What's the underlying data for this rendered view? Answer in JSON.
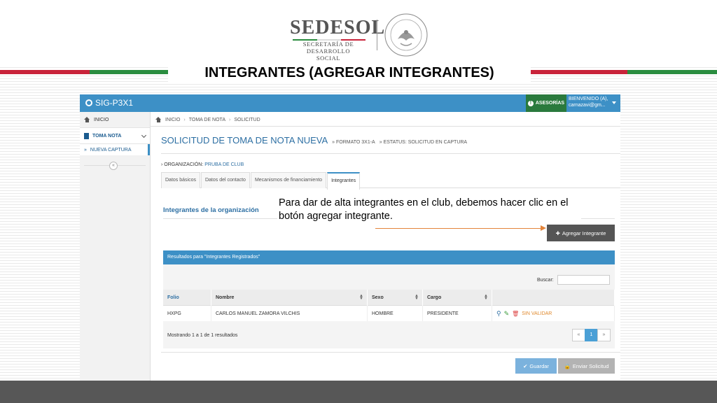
{
  "brand": {
    "name": "SEDESOL",
    "subtitle_1": "SECRETARÍA DE",
    "subtitle_2": "DESARROLLO SOCIAL",
    "colors": {
      "green": "#2a8c3f",
      "red": "#c8233a",
      "gray": "#555555"
    }
  },
  "slide": {
    "title": "INTEGRANTES (AGREGAR INTEGRANTES)"
  },
  "annotation": {
    "text": "Para dar de alta integrantes en el club, debemos hacer clic en el botón agregar integrante.",
    "arrow_color": "#e3843a"
  },
  "topbar": {
    "app_name": "SIG-P3X1",
    "asesorias": "ASESORÍAS",
    "welcome_1": "BIENVENIDO (A),",
    "welcome_2": "carnazavi@gm...",
    "color": "#3d90c6"
  },
  "sidebar": {
    "items": [
      {
        "label": "INICIO",
        "icon": "home-icon"
      },
      {
        "label": "TOMA NOTA",
        "icon": "document-icon"
      }
    ],
    "sub_items": [
      {
        "label": "NUEVA CAPTURA"
      }
    ],
    "toggle_glyph": "«"
  },
  "breadcrumb": {
    "items": [
      "INICIO",
      "TOMA DE NOTA",
      "SOLICITUD"
    ]
  },
  "main": {
    "title": "SOLICITUD DE TOMA DE NOTA NUEVA",
    "formato": "» FORMATO 3X1-A",
    "estatus": "» ESTATUS: SOLICITUD EN CAPTURA",
    "org_label": "ORGANIZACIÓN:",
    "org_value": "PRUBA DE CLUB",
    "tabs": [
      {
        "label": "Datos básicos"
      },
      {
        "label": "Datos del contacto"
      },
      {
        "label": "Mecanismos de financiamiento"
      },
      {
        "label": "Integrantes"
      }
    ],
    "section_title": "Integrantes de la organización",
    "add_button": "Agregar Integrante"
  },
  "results": {
    "header": "Resultados para \"Integrantes Registrados\"",
    "search_label": "Buscar:",
    "search_value": "",
    "columns": [
      "Folio",
      "Nombre",
      "Sexo",
      "Cargo",
      ""
    ],
    "rows": [
      {
        "folio": "HXPG",
        "nombre": "CARLOS MANUEL ZAMORA VILCHIS",
        "sexo": "HOMBRE",
        "cargo": "PRESIDENTE",
        "status": "SIN VALIDAR"
      }
    ],
    "showing": "Mostrando 1 a 1 de 1 resultados",
    "pager": [
      "«",
      "1",
      "»"
    ]
  },
  "actions": {
    "guardar": "Guardar",
    "enviar": "Enviar Solicitud"
  }
}
